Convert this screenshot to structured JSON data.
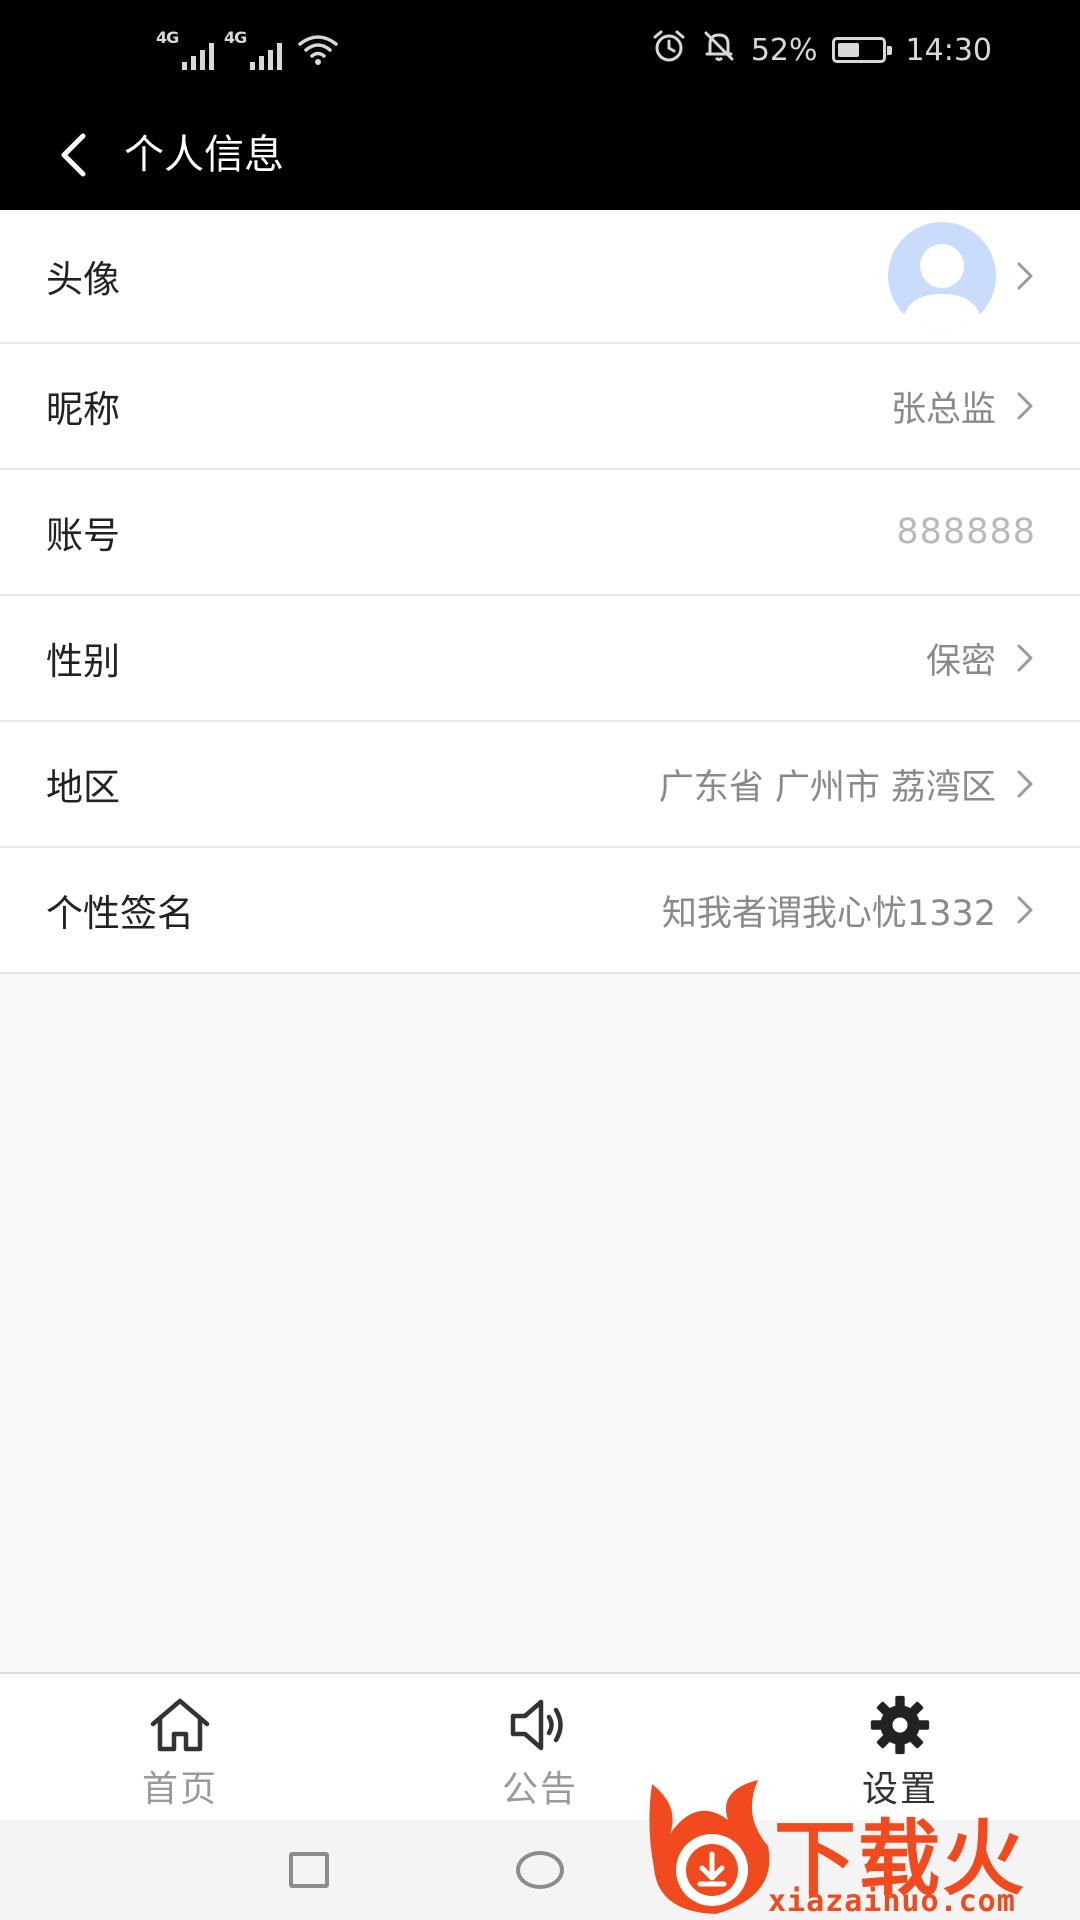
{
  "status_bar": {
    "network_1": "4G",
    "network_2": "4G",
    "battery_text": "52%",
    "battery_level": 0.52,
    "time": "14:30"
  },
  "header": {
    "title": "个人信息"
  },
  "profile": {
    "avatar_label": "头像",
    "nickname_label": "昵称",
    "nickname_value": "张总监",
    "account_label": "账号",
    "account_value": "888888",
    "gender_label": "性别",
    "gender_value": "保密",
    "region_label": "地区",
    "region_value": "广东省 广州市 荔湾区",
    "signature_label": "个性签名",
    "signature_value": "知我者谓我心忧1332"
  },
  "bottom_nav": {
    "items": [
      {
        "label": "首页",
        "icon": "home-icon"
      },
      {
        "label": "公告",
        "icon": "speaker-icon"
      },
      {
        "label": "设置",
        "icon": "gear-icon"
      }
    ],
    "active_index": 2
  },
  "watermark": {
    "brand": "下载火",
    "url": "xiazaihuo.com"
  },
  "colors": {
    "header_bg": "#000000",
    "avatar_bg": "#c9dcfb",
    "watermark": "#f04a1e",
    "value_text": "#8a8a8a"
  }
}
